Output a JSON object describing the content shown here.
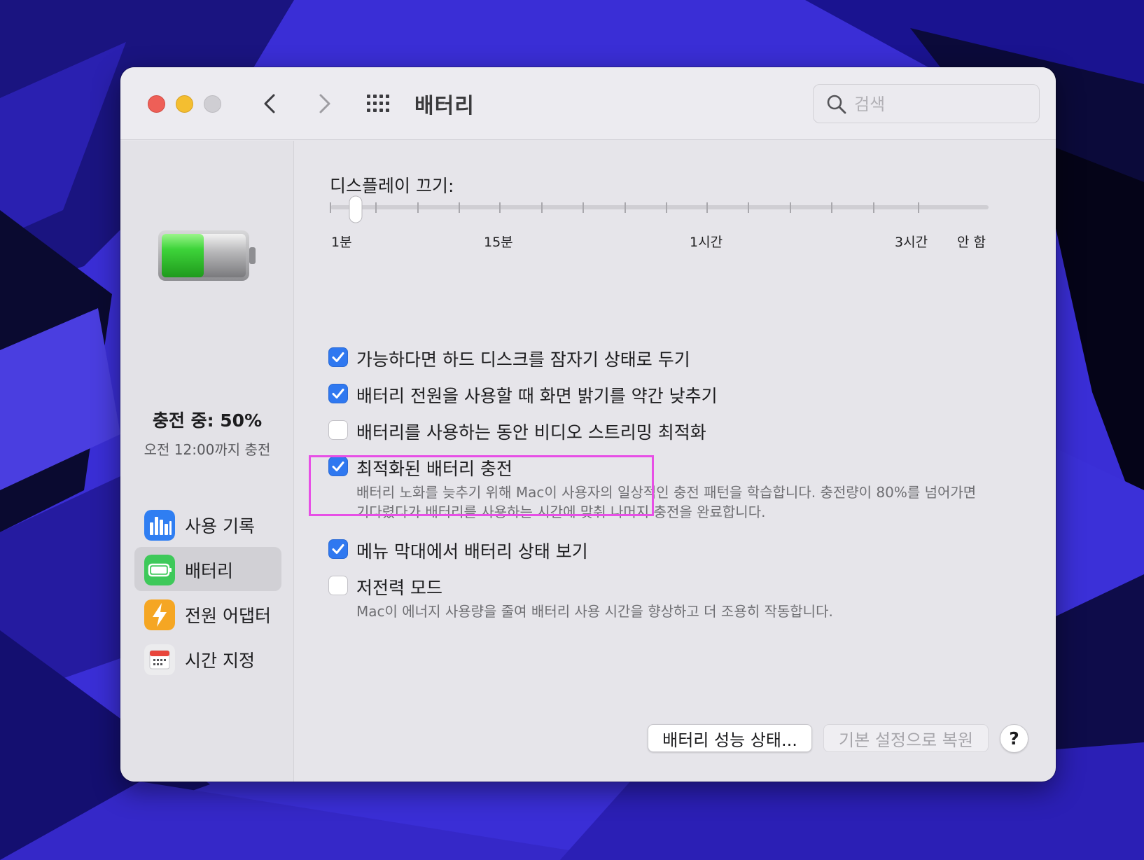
{
  "window": {
    "title": "배터리"
  },
  "search": {
    "placeholder": "검색",
    "value": ""
  },
  "sidebar": {
    "charge_status": "충전 중: 50%",
    "charge_until": "오전 12:00까지 충전",
    "battery_level": 0.5,
    "items": [
      {
        "label": "사용 기록",
        "icon": "usage-history-icon",
        "active": false
      },
      {
        "label": "배터리",
        "icon": "battery-icon",
        "active": true
      },
      {
        "label": "전원 어댑터",
        "icon": "power-adapter-icon",
        "active": false
      },
      {
        "label": "시간 지정",
        "icon": "schedule-icon",
        "active": false
      }
    ]
  },
  "display_off": {
    "label": "디스플레이 끄기:",
    "selected": "1분",
    "tick_labels": [
      "1분",
      "15분",
      "1시간",
      "3시간",
      "안 함"
    ]
  },
  "options": [
    {
      "label": "가능하다면 하드 디스크를 잠자기 상태로 두기",
      "checked": true
    },
    {
      "label": "배터리 전원을 사용할 때 화면 밝기를 약간 낮추기",
      "checked": true
    },
    {
      "label": "배터리를 사용하는 동안 비디오 스트리밍 최적화",
      "checked": false
    },
    {
      "label": "최적화된 배터리 충전",
      "checked": true,
      "description": [
        "배터리 노화를 늦추기 위해 Mac이 사용자의 일상적인 충전 패턴을 학습합니다. 충전량이 80%를 넘어가면",
        "기다렸다가 배터리를 사용하는 시간에 맞춰 나머지 충전을 완료합니다."
      ]
    },
    {
      "label": "메뉴 막대에서 배터리 상태 보기",
      "checked": true
    },
    {
      "label": "저전력 모드",
      "checked": false,
      "description": [
        "Mac이 에너지 사용량을 줄여 배터리 사용 시간을 향상하고 더 조용히 작동합니다."
      ]
    }
  ],
  "buttons": {
    "battery_health": "배터리 성능 상태...",
    "restore_defaults": "기본 설정으로 복원",
    "help": "?"
  },
  "colors": {
    "accent": "#2f78f0",
    "highlight": "#e74fe6",
    "battery_green": "#3ed43a"
  }
}
